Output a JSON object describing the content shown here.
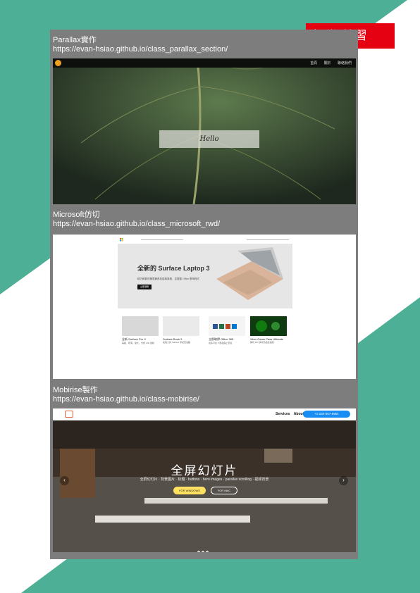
{
  "badge": "課堂 練習",
  "sections": [
    {
      "title": "Parallax實作",
      "url": "https://evan-hsiao.github.io/class_parallax_section/"
    },
    {
      "title": "Microsoft仿切",
      "url": "https://evan-hsiao.github.io/class_microsoft_rwd/"
    },
    {
      "title": "Mobirise製作",
      "url": "https://evan-hsiao.github.io/class-mobirise/"
    }
  ],
  "parallax": {
    "hello": "Hello",
    "nav": "首頁 關於 聯絡我們"
  },
  "microsoft": {
    "hero_title": "全新的 Surface Laptop 3",
    "hero_desc": "精巧輕盈的筆電兼具效能與風格，並搭載 Office 應用程式",
    "hero_button": "立即選購",
    "cards": [
      {
        "title": "全新 Surface Pro X",
        "desc": "美觀、輕薄、強大，支援 LTE 連線"
      },
      {
        "title": "Surface Book 3",
        "desc": "最強大的 Surface 筆記型電腦"
      },
      {
        "title": "立即取得 Office 365",
        "desc": "最多可在 5 部電腦上安裝"
      },
      {
        "title": "Xbox Game Pass Ultimate",
        "desc": "暢玩 100 多款高品質遊戲"
      }
    ],
    "colors": {
      "laptop": "#d9b49a",
      "card4": "#0e7a0d"
    }
  },
  "mobirise": {
    "nav": "Services About Us",
    "pill": "+1-234-567-8901",
    "hero_title": "全屏幻灯片",
    "hero_desc": "全屏幻灯片 · 背景图片 · 标题 · buttons · hero images · parallax scrolling · 视频背景",
    "btn1": "FOR WINDOWS",
    "btn2": "FOR MAC"
  },
  "colors": {
    "teal": "#4daf95",
    "panel": "#7d7d7d",
    "badge": "#e50012"
  }
}
